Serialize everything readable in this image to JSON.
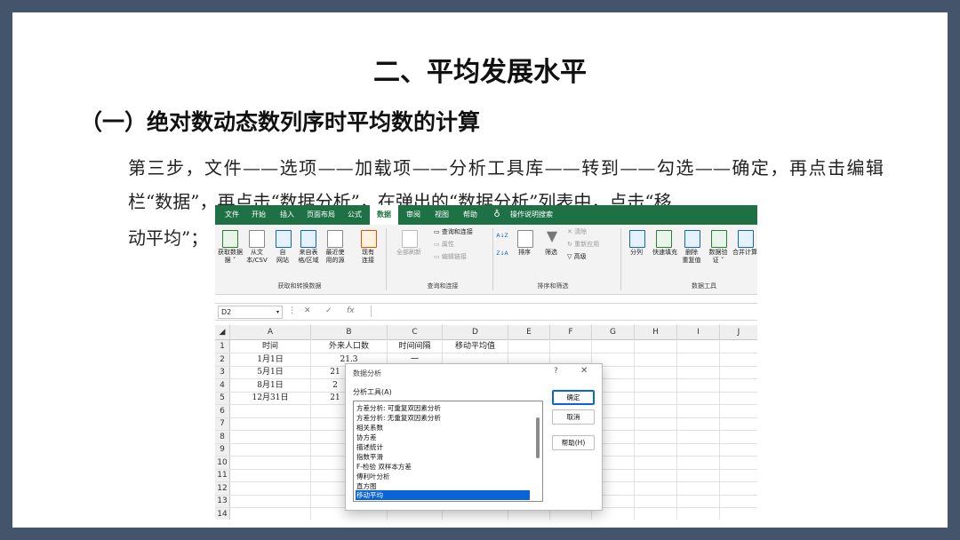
{
  "slide": {
    "title": "二、平均发展水平",
    "subtitle": "（一）绝对数动态数列序时平均数的计算",
    "paragraph": "第三步，文件——选项——加载项——分析工具库——转到——勾选——确定，再点击编辑栏“数据”，再点击“数据分析”，在弹出的“数据分析”列表中，点击“移",
    "paragraph_tail": "动平均”；"
  },
  "excel": {
    "tabs": [
      "文件",
      "开始",
      "插入",
      "页面布局",
      "公式",
      "数据",
      "审阅",
      "视图",
      "帮助"
    ],
    "active_tab": "数据",
    "tell_me": "操作说明搜索",
    "ribbon": {
      "get_data": "获取数据",
      "get_data2": "据 ˅",
      "from_text": "从文",
      "from_text2": "本/CSV",
      "from_web": "自",
      "from_web2": "网站",
      "from_table": "来自表",
      "from_table2": "格/区域",
      "recent": "最近使",
      "recent2": "用的源",
      "existing": "现有",
      "existing2": "连接",
      "group1": "获取和转换数据",
      "refresh_all": "全部刷新",
      "queries": "查询和连接",
      "properties": "属性",
      "edit_links": "编辑链接",
      "group2": "查询和连接",
      "sort_az": "A↓Z",
      "sort_za": "Z↓A",
      "sort": "排序",
      "filter": "筛选",
      "clear": "清除",
      "reapply": "重新应用",
      "advanced": "高级",
      "group3": "排序和筛选",
      "split": "分列",
      "flash_fill": "快速填充",
      "remove_dup": "删除",
      "remove_dup2": "重复值",
      "validation": "数据验",
      "validation2": "证 ˅",
      "consolidate": "合并计算",
      "group4": "数据工具"
    },
    "name_box": "D2",
    "formula_symbols": {
      "cancel": "✕",
      "enter": "✓",
      "fx": "fx"
    },
    "columns": [
      "A",
      "B",
      "C",
      "D",
      "E",
      "F",
      "G",
      "H",
      "I",
      "J"
    ],
    "rows": [
      "1",
      "2",
      "3",
      "4",
      "5",
      "6",
      "7",
      "8",
      "9",
      "10",
      "11",
      "12",
      "13",
      "14"
    ],
    "cells": {
      "A1": "时间",
      "B1": "外来人口数",
      "C1": "时间间隔",
      "D1": "移动平均值",
      "A2": "1月1日",
      "B2": "21.3",
      "C2": "一",
      "A3": "5月1日",
      "B3": "21",
      "A4": "8月1日",
      "B4": "2",
      "A5": "12月31日",
      "B5": "21"
    },
    "dialog": {
      "title": "数据分析",
      "help_q": "?",
      "close": "✕",
      "tools_label": "分析工具(A)",
      "items": [
        "方差分析: 可重复双因素分析",
        "方差分析: 无重复双因素分析",
        "相关系数",
        "协方差",
        "描述统计",
        "指数平滑",
        "F-检验 双样本方差",
        "傅利叶分析",
        "直方图",
        "移动平均"
      ],
      "selected": "移动平均",
      "ok": "确定",
      "cancel": "取消",
      "help": "帮助(H)"
    }
  },
  "colors": {
    "frame": "#44546a",
    "excel_green": "#1e7145",
    "selection": "#0a64d8"
  }
}
